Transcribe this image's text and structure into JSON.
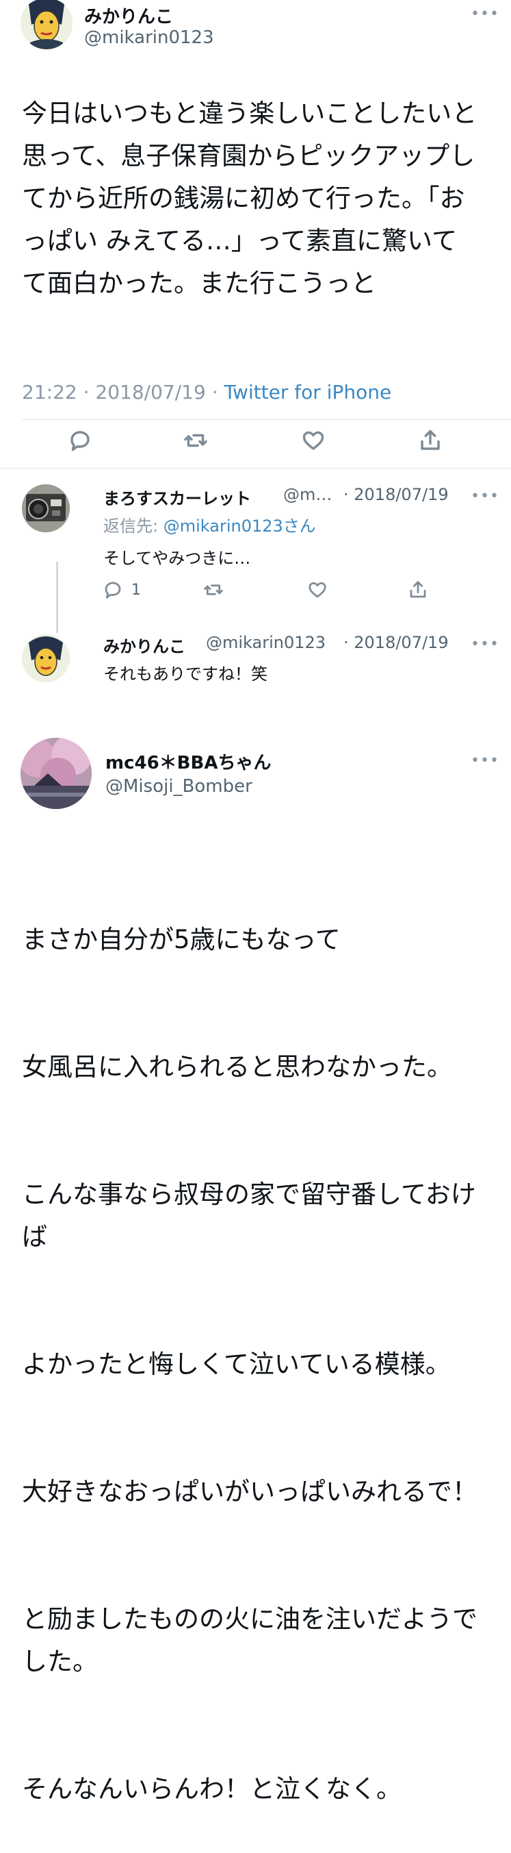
{
  "main_tweet": {
    "author_name": "みかりんこ",
    "author_handle": "@mikarin0123",
    "more": "•••",
    "text": "今日はいつもと違う楽しいことしたいと思って、息子保育園からピックアップしてから近所の銭湯に初めて行った。「おっぱい みえてる…」って素直に驚いてて面白かった。また行こうっと",
    "time": "21:22",
    "date": "2018/07/19",
    "separator": "·",
    "client": "Twitter for iPhone",
    "actions": [
      "reply-icon",
      "retweet-icon",
      "like-icon",
      "share-icon"
    ]
  },
  "reply1": {
    "author_name": "まろすスカーレット",
    "author_handle": "@m…",
    "date": "· 2018/07/19",
    "more": "•••",
    "reply_to_label": "返信先: ",
    "reply_to_user": "@mikarin0123さん",
    "text": "そしてやみつきに…",
    "reply_count": "1"
  },
  "reply2": {
    "author_name": "みかりんこ",
    "author_handle": "@mikarin0123",
    "date": "· 2018/07/19",
    "more": "•••",
    "text": "それもありですね！笑"
  },
  "tweet2": {
    "author_name": "mc46＊BBAちゃん",
    "author_handle": "@Misoji_Bomber",
    "more": "•••",
    "lines": [
      "まさか自分が5歳にもなって",
      "女風呂に入れられると思わなかった。",
      "こんな事なら叔母の家で留守番しておけば",
      "よかったと悔しくて泣いている模様。",
      "大好きなおっぱいがいっぱいみれるで！",
      "と励ましたものの火に油を注いだようでした。",
      "そんなんいらんわ！と泣くなく。"
    ]
  },
  "colors": {
    "link": "#3b88c3",
    "secondary": "#8b98a5",
    "text": "#0f1419",
    "divider": "#e1e6ea"
  }
}
